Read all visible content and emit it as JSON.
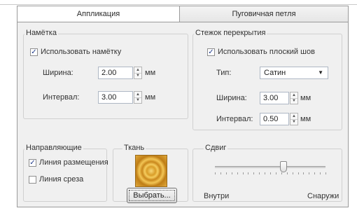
{
  "tabs": [
    {
      "label": "Аппликация",
      "active": true
    },
    {
      "label": "Пуговичная петля",
      "active": false
    }
  ],
  "nametka": {
    "legend": "Намётка",
    "use_checkbox_label": "Использовать намётку",
    "use_checked": true,
    "width_label": "Ширина:",
    "width_value": "2.00",
    "width_unit": "мм",
    "interval_label": "Интервал:",
    "interval_value": "3.00",
    "interval_unit": "мм"
  },
  "overlap": {
    "legend": "Стежок перекрытия",
    "flat_checkbox_label": "Использовать плоский шов",
    "flat_checked": true,
    "type_label": "Тип:",
    "type_value": "Сатин",
    "width_label": "Ширина:",
    "width_value": "3.00",
    "width_unit": "мм",
    "interval_label": "Интервал:",
    "interval_value": "0.50",
    "interval_unit": "мм"
  },
  "guides": {
    "legend": "Направляющие",
    "placement_label": "Линия размещения",
    "placement_checked": true,
    "cut_label": "Линия среза",
    "cut_checked": false
  },
  "fabric": {
    "legend": "Ткань",
    "choose_button": "Выбрать..."
  },
  "shift": {
    "legend": "Сдвиг",
    "inside_label": "Внутри",
    "outside_label": "Снаружи",
    "slider_fraction": 0.62
  },
  "icons": {
    "check": "✓",
    "spin_up": "▲",
    "spin_down": "▼",
    "dropdown": "▼"
  }
}
